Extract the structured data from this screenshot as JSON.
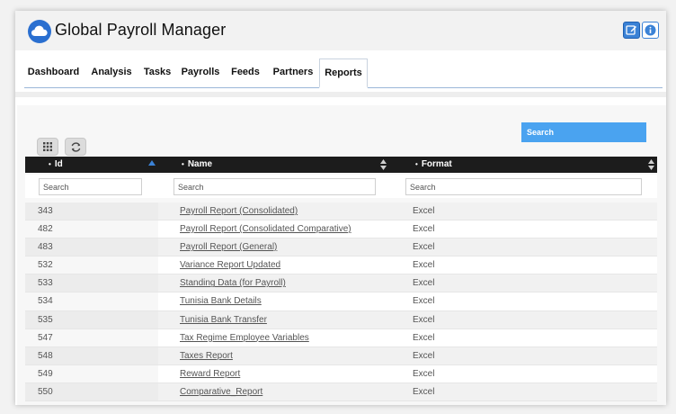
{
  "header": {
    "title": "Global Payroll Manager",
    "icons": [
      "cloud-icon",
      "edit-icon",
      "info-icon"
    ]
  },
  "tabs": [
    {
      "label": "Dashboard"
    },
    {
      "label": "Analysis"
    },
    {
      "label": "Tasks"
    },
    {
      "label": "Payrolls"
    },
    {
      "label": "Feeds"
    },
    {
      "label": "Partners"
    },
    {
      "label": "Reports",
      "active": true
    }
  ],
  "toolbar": {
    "global_search_placeholder": "Search"
  },
  "table": {
    "columns": [
      {
        "label": "Id"
      },
      {
        "label": "Name"
      },
      {
        "label": "Format"
      }
    ],
    "filter_placeholders": [
      "Search",
      "Search",
      "Search"
    ],
    "rows": [
      {
        "id": "343",
        "name": "Payroll Report (Consolidated)",
        "format": "Excel"
      },
      {
        "id": "482",
        "name": "Payroll Report (Consolidated Comparative)",
        "format": "Excel"
      },
      {
        "id": "483",
        "name": "Payroll Report (General)",
        "format": "Excel"
      },
      {
        "id": "532",
        "name": "Variance Report Updated",
        "format": "Excel"
      },
      {
        "id": "533",
        "name": "Standing Data (for Payroll)",
        "format": "Excel"
      },
      {
        "id": "534",
        "name": "Tunisia Bank Details",
        "format": "Excel"
      },
      {
        "id": "535",
        "name": "Tunisia Bank Transfer",
        "format": "Excel"
      },
      {
        "id": "547",
        "name": "Tax Regime Employee Variables",
        "format": "Excel"
      },
      {
        "id": "548",
        "name": "Taxes Report",
        "format": "Excel"
      },
      {
        "id": "549",
        "name": "Reward Report",
        "format": "Excel"
      },
      {
        "id": "550",
        "name": "Comparative_Report",
        "format": "Excel"
      }
    ]
  },
  "colors": {
    "accent": "#3b82d6",
    "search_bg": "#4aa3f0",
    "table_header_bg": "#1c1c1c"
  }
}
